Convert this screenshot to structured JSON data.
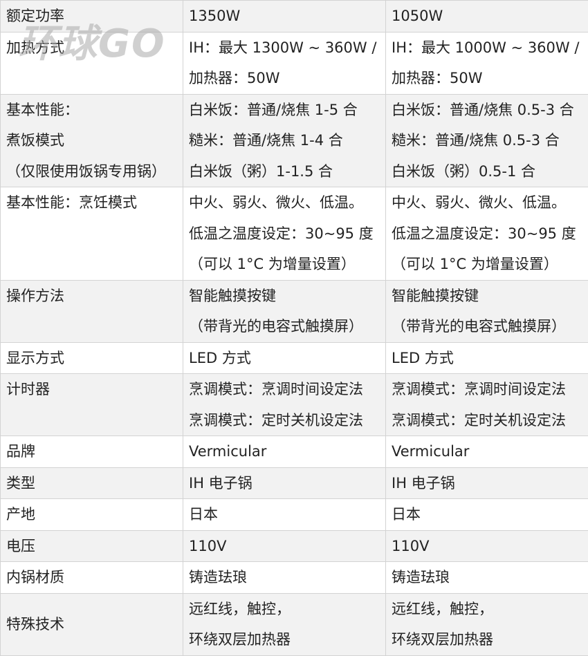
{
  "watermark": "环球GO",
  "rows": [
    {
      "label": [
        "额定功率"
      ],
      "a": [
        "1350W"
      ],
      "b": [
        "1050W"
      ]
    },
    {
      "label": [
        "加热方式"
      ],
      "a": [
        "IH：最大 1300W ~ 360W /",
        "加热器：50W"
      ],
      "b": [
        "IH：最大 1000W ~ 360W /",
        "加热器：50W"
      ]
    },
    {
      "label": [
        "基本性能：",
        "煮饭模式",
        "（仅限使用饭锅专用锅）"
      ],
      "a": [
        "白米饭：普通/烧焦 1-5 合",
        "糙米：普通/烧焦 1-4 合",
        "白米饭（粥）1-1.5 合"
      ],
      "b": [
        "白米饭：普通/烧焦 0.5-3 合",
        "糙米：普通/烧焦 0.5-3 合",
        "白米饭（粥）0.5-1 合"
      ]
    },
    {
      "label": [
        "基本性能：烹饪模式"
      ],
      "a": [
        "中火、弱火、微火、低温。",
        "低温之温度设定：30~95 度",
        "（可以 1°C 为增量设置）"
      ],
      "b": [
        "中火、弱火、微火、低温。",
        "低温之温度设定：30~95 度",
        "（可以 1°C 为增量设置）"
      ]
    },
    {
      "label": [
        "操作方法"
      ],
      "a": [
        "智能触摸按键",
        "（带背光的电容式触摸屏）"
      ],
      "b": [
        "智能触摸按键",
        "（带背光的电容式触摸屏）"
      ]
    },
    {
      "label": [
        "显示方式"
      ],
      "a": [
        "LED 方式"
      ],
      "b": [
        "LED 方式"
      ]
    },
    {
      "label": [
        "计时器"
      ],
      "a": [
        "烹调模式：烹调时间设定法",
        "烹调模式：定时关机设定法"
      ],
      "b": [
        "烹调模式：烹调时间设定法",
        "烹调模式：定时关机设定法"
      ]
    },
    {
      "label": [
        "品牌"
      ],
      "a": [
        "Vermicular"
      ],
      "b": [
        "Vermicular"
      ]
    },
    {
      "label": [
        "类型"
      ],
      "a": [
        "IH 电子锅"
      ],
      "b": [
        "IH 电子锅"
      ]
    },
    {
      "label": [
        "产地"
      ],
      "a": [
        "日本"
      ],
      "b": [
        "日本"
      ]
    },
    {
      "label": [
        "电压"
      ],
      "a": [
        "110V"
      ],
      "b": [
        "110V"
      ]
    },
    {
      "label": [
        "内锅材质"
      ],
      "a": [
        "铸造珐琅"
      ],
      "b": [
        "铸造珐琅"
      ]
    },
    {
      "label": [
        "特殊技术"
      ],
      "a": [
        "远红线，触控，",
        "环绕双层加热器"
      ],
      "b": [
        "远红线，触控，",
        "环绕双层加热器"
      ]
    }
  ]
}
